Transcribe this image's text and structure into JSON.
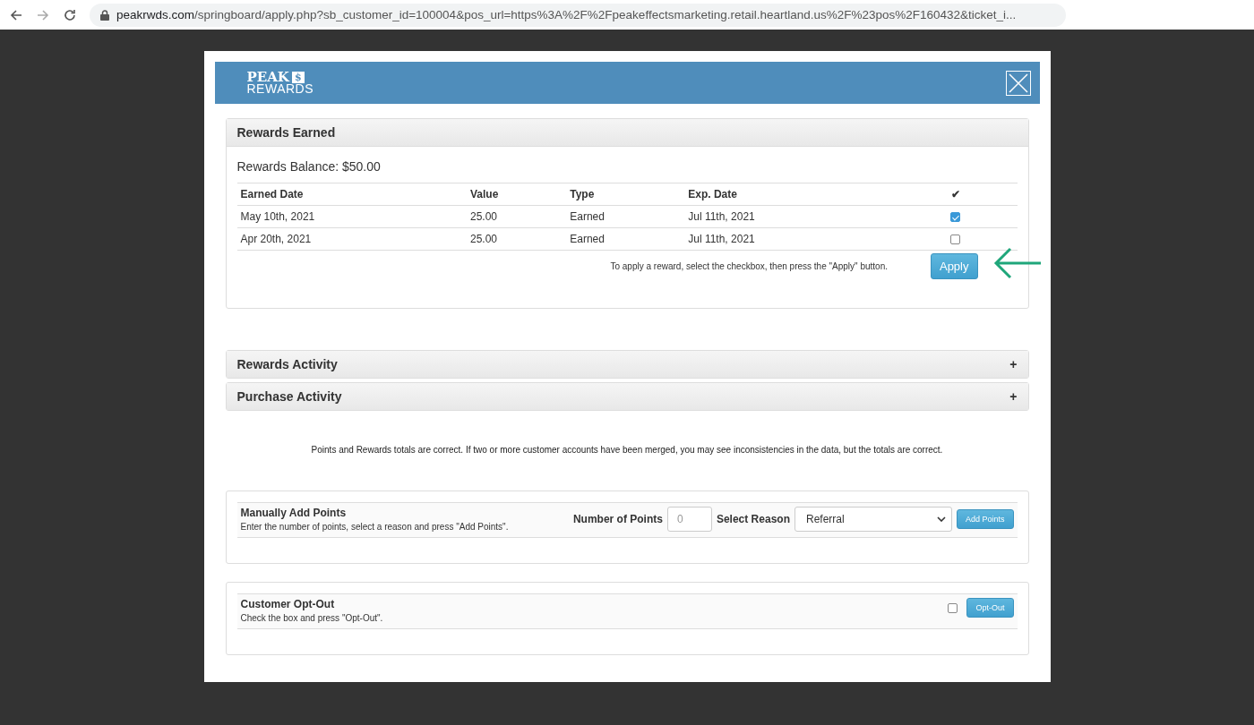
{
  "browser": {
    "url_host": "peakrwds.com",
    "url_path": "/springboard/apply.php?sb_customer_id=100004&pos_url=https%3A%2F%2Fpeakeffectsmarketing.retail.heartland.us%2F%23pos%2F160432&ticket_i..."
  },
  "logo": {
    "top": "PEAK",
    "badge": "$",
    "bottom": "REWARDS"
  },
  "rewards_earned": {
    "title": "Rewards Earned",
    "balance": "Rewards Balance: $50.00",
    "columns": [
      "Earned Date",
      "Value",
      "Type",
      "Exp. Date",
      "✔"
    ],
    "rows": [
      {
        "earned_date": "May 10th, 2021",
        "value": "25.00",
        "type": "Earned",
        "exp_date": "Jul 11th, 2021",
        "checked": true
      },
      {
        "earned_date": "Apr 20th, 2021",
        "value": "25.00",
        "type": "Earned",
        "exp_date": "Jul 11th, 2021",
        "checked": false
      }
    ],
    "hint": "To apply a reward, select the checkbox, then press the \"Apply\" button.",
    "apply_button": "Apply"
  },
  "sections": [
    {
      "title": "Rewards Activity",
      "toggle": "+",
      "expanded": false
    },
    {
      "title": "Purchase Activity",
      "toggle": "+",
      "expanded": false
    }
  ],
  "note": "Points and Rewards totals are correct. If two or more customer accounts have been merged, you may see inconsistencies in the data, but the totals are correct.",
  "add_points": {
    "title": "Manually Add Points",
    "description": "Enter the number of points, select a reason and press \"Add Points\".",
    "points_label": "Number of Points",
    "points_placeholder": "0",
    "reason_label": "Select Reason",
    "reason_value": "Referral",
    "button": "Add Points"
  },
  "opt_out": {
    "title": "Customer Opt-Out",
    "description": "Check the box and press \"Opt-Out\".",
    "checked": false,
    "button": "Opt-Out"
  }
}
